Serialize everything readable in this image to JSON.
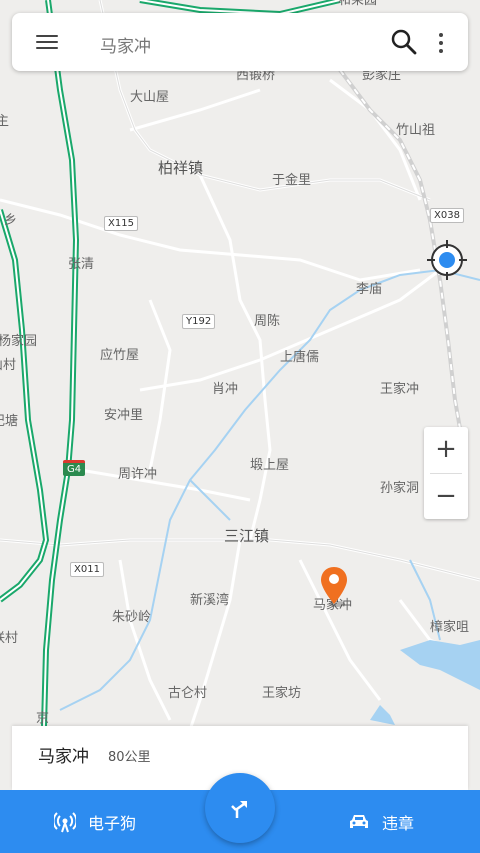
{
  "search": {
    "query": "马家冲"
  },
  "map": {
    "places": [
      {
        "id": "xiduanqiao",
        "name": "西锻桥"
      },
      {
        "id": "pengjiazhuang",
        "name": "彭家庄"
      },
      {
        "id": "dashanwu",
        "name": "大山屋"
      },
      {
        "id": "zhushanzu",
        "name": "竹山祖"
      },
      {
        "id": "baixiangzhen",
        "name": "柏祥镇"
      },
      {
        "id": "yujinli",
        "name": "于金里"
      },
      {
        "id": "zhangqing",
        "name": "张清"
      },
      {
        "id": "limiao",
        "name": "李庙"
      },
      {
        "id": "zhouchen",
        "name": "周陈"
      },
      {
        "id": "yingzhuwu",
        "name": "应竹屋"
      },
      {
        "id": "shangtangru",
        "name": "上唐儒"
      },
      {
        "id": "xiaochong",
        "name": "肖冲"
      },
      {
        "id": "wangjiachong",
        "name": "王家冲"
      },
      {
        "id": "anchongli",
        "name": "安冲里"
      },
      {
        "id": "zhouxuchong",
        "name": "周许冲"
      },
      {
        "id": "kanshangwu",
        "name": "塅上屋"
      },
      {
        "id": "sunjiadong",
        "name": "孙家洞"
      },
      {
        "id": "sanjiangzhen",
        "name": "三江镇"
      },
      {
        "id": "xinxiwan",
        "name": "新溪湾"
      },
      {
        "id": "zhushaling",
        "name": "朱砂岭"
      },
      {
        "id": "majiachong",
        "name": "马家冲"
      },
      {
        "id": "zhangjiaju",
        "name": "樟家咀"
      },
      {
        "id": "guluncun",
        "name": "古仑村"
      },
      {
        "id": "wangjiafang",
        "name": "王家坊"
      },
      {
        "id": "yangjiayuan",
        "name": "杨家园"
      },
      {
        "id": "shancun",
        "name": "山村"
      },
      {
        "id": "jitang",
        "name": "记塘"
      },
      {
        "id": "liancun",
        "name": "联村"
      },
      {
        "id": "xiang",
        "name": "乡"
      },
      {
        "id": "zhu",
        "name": "主"
      },
      {
        "id": "hemaoyuan",
        "name": "和茉园"
      },
      {
        "id": "jing",
        "name": "京"
      }
    ],
    "route_badges": [
      "X115",
      "Y192",
      "X038",
      "X011"
    ],
    "highway_badge": "G4",
    "colors": {
      "highway": "#1aa86b",
      "water": "#a6d2f2",
      "rail": "#c8c8c8",
      "accent": "#2d8cf0",
      "marker": "#f07020"
    }
  },
  "info_card": {
    "name": "马家冲",
    "distance": "80公里"
  },
  "bottom_bar": {
    "left_label": "电子狗",
    "right_label": "违章"
  }
}
